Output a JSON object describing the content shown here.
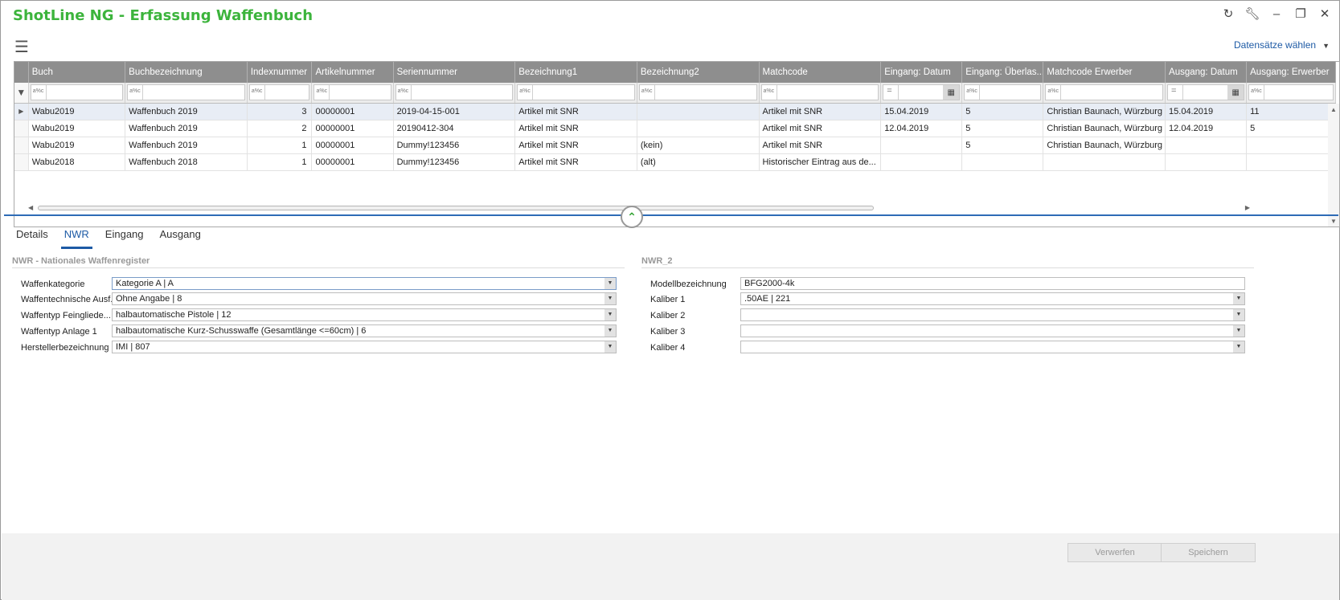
{
  "app": {
    "title": "ShotLine NG - Erfassung Waffenbuch",
    "records_select_label": "Datensätze wählen"
  },
  "grid": {
    "columns": [
      "Buch",
      "Buchbezeichnung",
      "Indexnummer",
      "Artikelnummer",
      "Seriennummer",
      "Bezeichnung1",
      "Bezeichnung2",
      "Matchcode",
      "Eingang: Datum",
      "Eingang: Überlas...",
      "Matchcode Erwerber",
      "Ausgang: Datum",
      "Ausgang: Erwerber"
    ],
    "filter_op_text": "a%c",
    "filter_op_eq": "=",
    "rows": [
      [
        "Wabu2019",
        "Waffenbuch 2019",
        "3",
        "00000001",
        "2019-04-15-001",
        "Artikel mit SNR",
        "",
        "Artikel mit SNR",
        "15.04.2019",
        "5",
        "Christian Baunach, Würzburg",
        "15.04.2019",
        "11"
      ],
      [
        "Wabu2019",
        "Waffenbuch 2019",
        "2",
        "00000001",
        "20190412-304",
        "Artikel mit SNR",
        "",
        "Artikel mit SNR",
        "12.04.2019",
        "5",
        "Christian Baunach, Würzburg",
        "12.04.2019",
        "5"
      ],
      [
        "Wabu2019",
        "Waffenbuch 2019",
        "1",
        "00000001",
        "Dummy!123456",
        "Artikel mit SNR",
        "(kein)",
        "Artikel mit SNR",
        "",
        "5",
        "Christian Baunach, Würzburg",
        "",
        ""
      ],
      [
        "Wabu2018",
        "Waffenbuch 2018",
        "1",
        "00000001",
        "Dummy!123456",
        "Artikel mit SNR",
        "(alt)",
        "Historischer Eintrag aus de...",
        "",
        "",
        "",
        "",
        ""
      ]
    ]
  },
  "tabs": [
    {
      "label": "Details",
      "active": false
    },
    {
      "label": "NWR",
      "active": true
    },
    {
      "label": "Eingang",
      "active": false
    },
    {
      "label": "Ausgang",
      "active": false
    }
  ],
  "nwr": {
    "section_title": "NWR - Nationales Waffenregister",
    "fields": [
      {
        "label": "Waffenkategorie",
        "value": "Kategorie A  |  A"
      },
      {
        "label": "Waffentechnische Ausf.",
        "value": "Ohne Angabe  |  8"
      },
      {
        "label": "Waffentyp Feingliede...",
        "value": "halbautomatische Pistole  |  12"
      },
      {
        "label": "Waffentyp Anlage 1",
        "value": "halbautomatische Kurz-Schusswaffe (Gesamtlänge <=60cm)  |  6"
      },
      {
        "label": "Herstellerbezeichnung",
        "value": "IMI  |  807"
      }
    ]
  },
  "nwr2": {
    "section_title": "NWR_2",
    "model_label": "Modellbezeichnung",
    "model_value": "BFG2000-4k",
    "fields": [
      {
        "label": "Kaliber 1",
        "value": ".50AE  |  221"
      },
      {
        "label": "Kaliber 2",
        "value": ""
      },
      {
        "label": "Kaliber 3",
        "value": ""
      },
      {
        "label": "Kaliber 4",
        "value": ""
      }
    ]
  },
  "footer": {
    "discard_label": "Verwerfen",
    "save_label": "Speichern"
  },
  "colors": {
    "title_green": "#3cb43c",
    "accent_blue": "#1d5aa5",
    "header_gray": "#8e8e8e"
  }
}
